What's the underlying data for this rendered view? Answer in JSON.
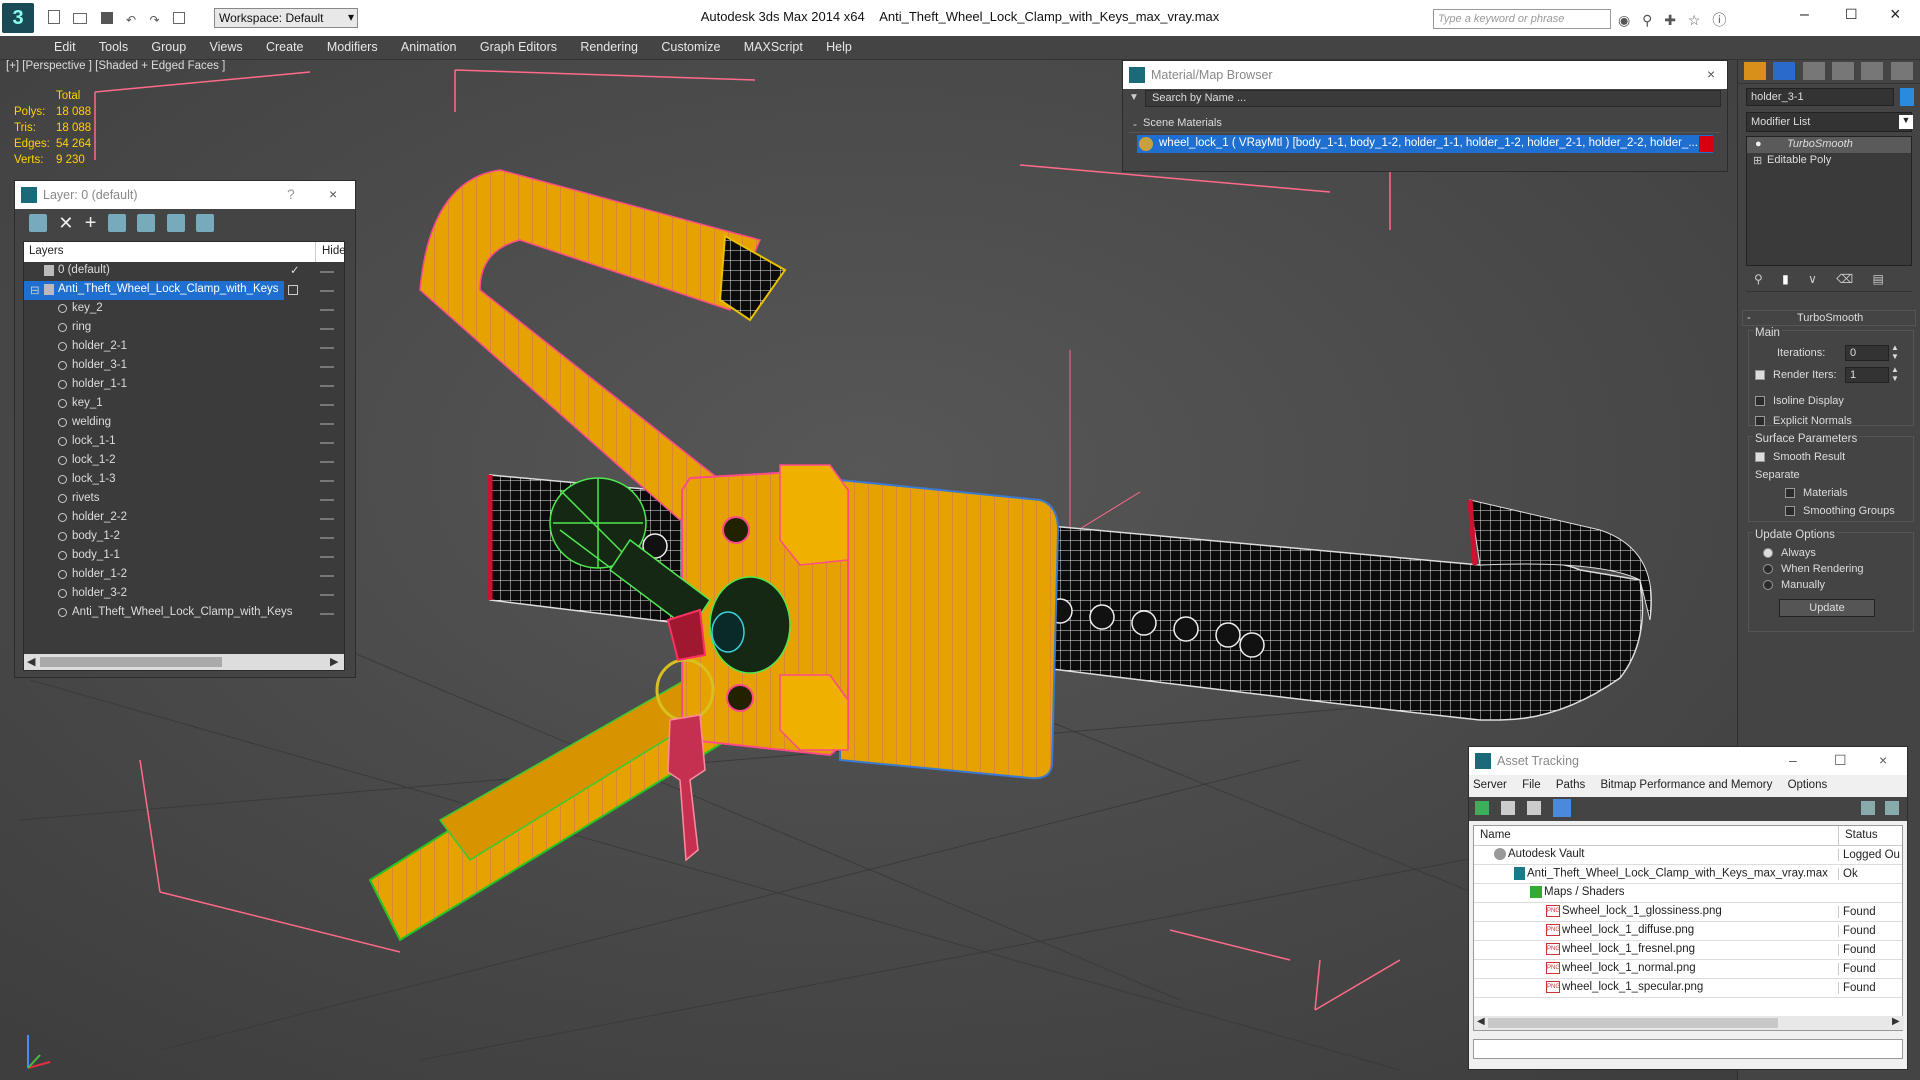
{
  "app": {
    "title": "Autodesk 3ds Max  2014 x64",
    "file": "Anti_Theft_Wheel_Lock_Clamp_with_Keys_max_vray.max",
    "workspace": "Workspace: Default",
    "search_placeholder": "Type a keyword or phrase"
  },
  "menu": [
    "Edit",
    "Tools",
    "Group",
    "Views",
    "Create",
    "Modifiers",
    "Animation",
    "Graph Editors",
    "Rendering",
    "Customize",
    "MAXScript",
    "Help"
  ],
  "viewport": {
    "label": "[+] [Perspective ] [Shaded + Edged Faces ]",
    "stats_header": "Total",
    "stats": [
      {
        "k": "Polys:",
        "v": "18 088"
      },
      {
        "k": "Tris:",
        "v": "18 088"
      },
      {
        "k": "Edges:",
        "v": "54 264"
      },
      {
        "k": "Verts:",
        "v": "9 230"
      }
    ]
  },
  "layer_panel": {
    "title": "Layer: 0 (default)",
    "help": "?",
    "col_layers": "Layers",
    "col_hide": "Hide",
    "root": "0 (default)",
    "group": "Anti_Theft_Wheel_Lock_Clamp_with_Keys",
    "items": [
      "key_2",
      "ring",
      "holder_2-1",
      "holder_3-1",
      "holder_1-1",
      "key_1",
      "welding",
      "lock_1-1",
      "lock_1-2",
      "lock_1-3",
      "rivets",
      "holder_2-2",
      "body_1-2",
      "body_1-1",
      "holder_1-2",
      "holder_3-2",
      "Anti_Theft_Wheel_Lock_Clamp_with_Keys"
    ]
  },
  "material_browser": {
    "title": "Material/Map Browser",
    "search": "Search by Name ...",
    "section": "Scene Materials",
    "material": "wheel_lock_1  ( VRayMtl ) [body_1-1, body_1-2, holder_1-1, holder_1-2, holder_2-1, holder_2-2, holder_..."
  },
  "command_panel": {
    "object_name": "holder_3-1",
    "modifier_list": "Modifier List",
    "stack": [
      "TurboSmooth",
      "Editable Poly"
    ],
    "rollout": "TurboSmooth",
    "main": "Main",
    "iterations_label": "Iterations:",
    "iterations": "0",
    "render_iters_label": "Render Iters:",
    "render_iters": "1",
    "isoline": "Isoline Display",
    "explicit": "Explicit Normals",
    "surface": "Surface Parameters",
    "smooth_result": "Smooth Result",
    "separate": "Separate",
    "materials": "Materials",
    "smoothing_groups": "Smoothing Groups",
    "update_options": "Update Options",
    "always": "Always",
    "when_rendering": "When Rendering",
    "manually": "Manually",
    "update_btn": "Update"
  },
  "asset_tracking": {
    "title": "Asset Tracking",
    "menu": [
      "Server",
      "File",
      "Paths",
      "Bitmap Performance and Memory",
      "Options"
    ],
    "col_name": "Name",
    "col_status": "Status",
    "rows": [
      {
        "name": "Autodesk Vault",
        "status": "Logged Ou"
      },
      {
        "name": "Anti_Theft_Wheel_Lock_Clamp_with_Keys_max_vray.max",
        "status": "Ok"
      },
      {
        "name": "Maps / Shaders",
        "status": ""
      },
      {
        "name": "Swheel_lock_1_glossiness.png",
        "status": "Found"
      },
      {
        "name": "wheel_lock_1_diffuse.png",
        "status": "Found"
      },
      {
        "name": "wheel_lock_1_fresnel.png",
        "status": "Found"
      },
      {
        "name": "wheel_lock_1_normal.png",
        "status": "Found"
      },
      {
        "name": "wheel_lock_1_specular.png",
        "status": "Found"
      }
    ]
  },
  "colors": {
    "selection": "#1e6fd0",
    "orange": "#e8a400",
    "accent_red": "#ff6a8a"
  }
}
